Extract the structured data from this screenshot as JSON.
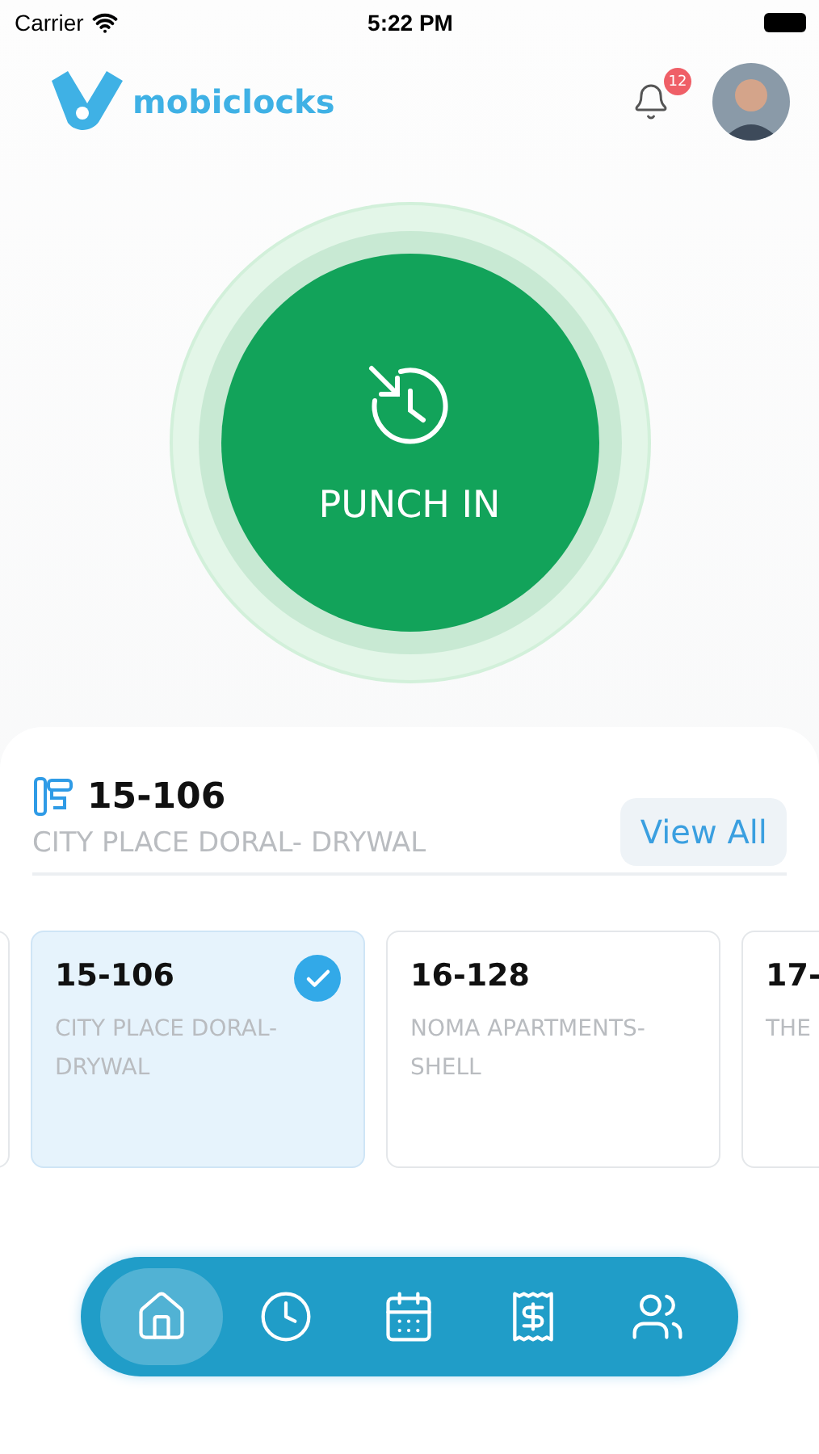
{
  "status_bar": {
    "carrier": "Carrier",
    "time": "5:22 PM"
  },
  "header": {
    "brand": "mobiclocks",
    "notification_count": "12"
  },
  "punch_button": {
    "label": "PUNCH IN"
  },
  "current_project": {
    "code": "15-106",
    "name": "CITY PLACE DORAL- DRYWAL",
    "action": "View All"
  },
  "projects": [
    {
      "code": "15-106",
      "name": "CITY PLACE DORAL- DRYWAL",
      "selected": true
    },
    {
      "code": "16-128",
      "name": "NOMA APARTMENTS-SHELL",
      "selected": false
    },
    {
      "code": "17-",
      "name": "THE",
      "selected": false
    }
  ],
  "nav": [
    {
      "kind": "home",
      "selected": true
    },
    {
      "kind": "clock",
      "selected": false
    },
    {
      "kind": "calendar",
      "selected": false
    },
    {
      "kind": "receipt",
      "selected": false
    },
    {
      "kind": "people",
      "selected": false
    }
  ]
}
